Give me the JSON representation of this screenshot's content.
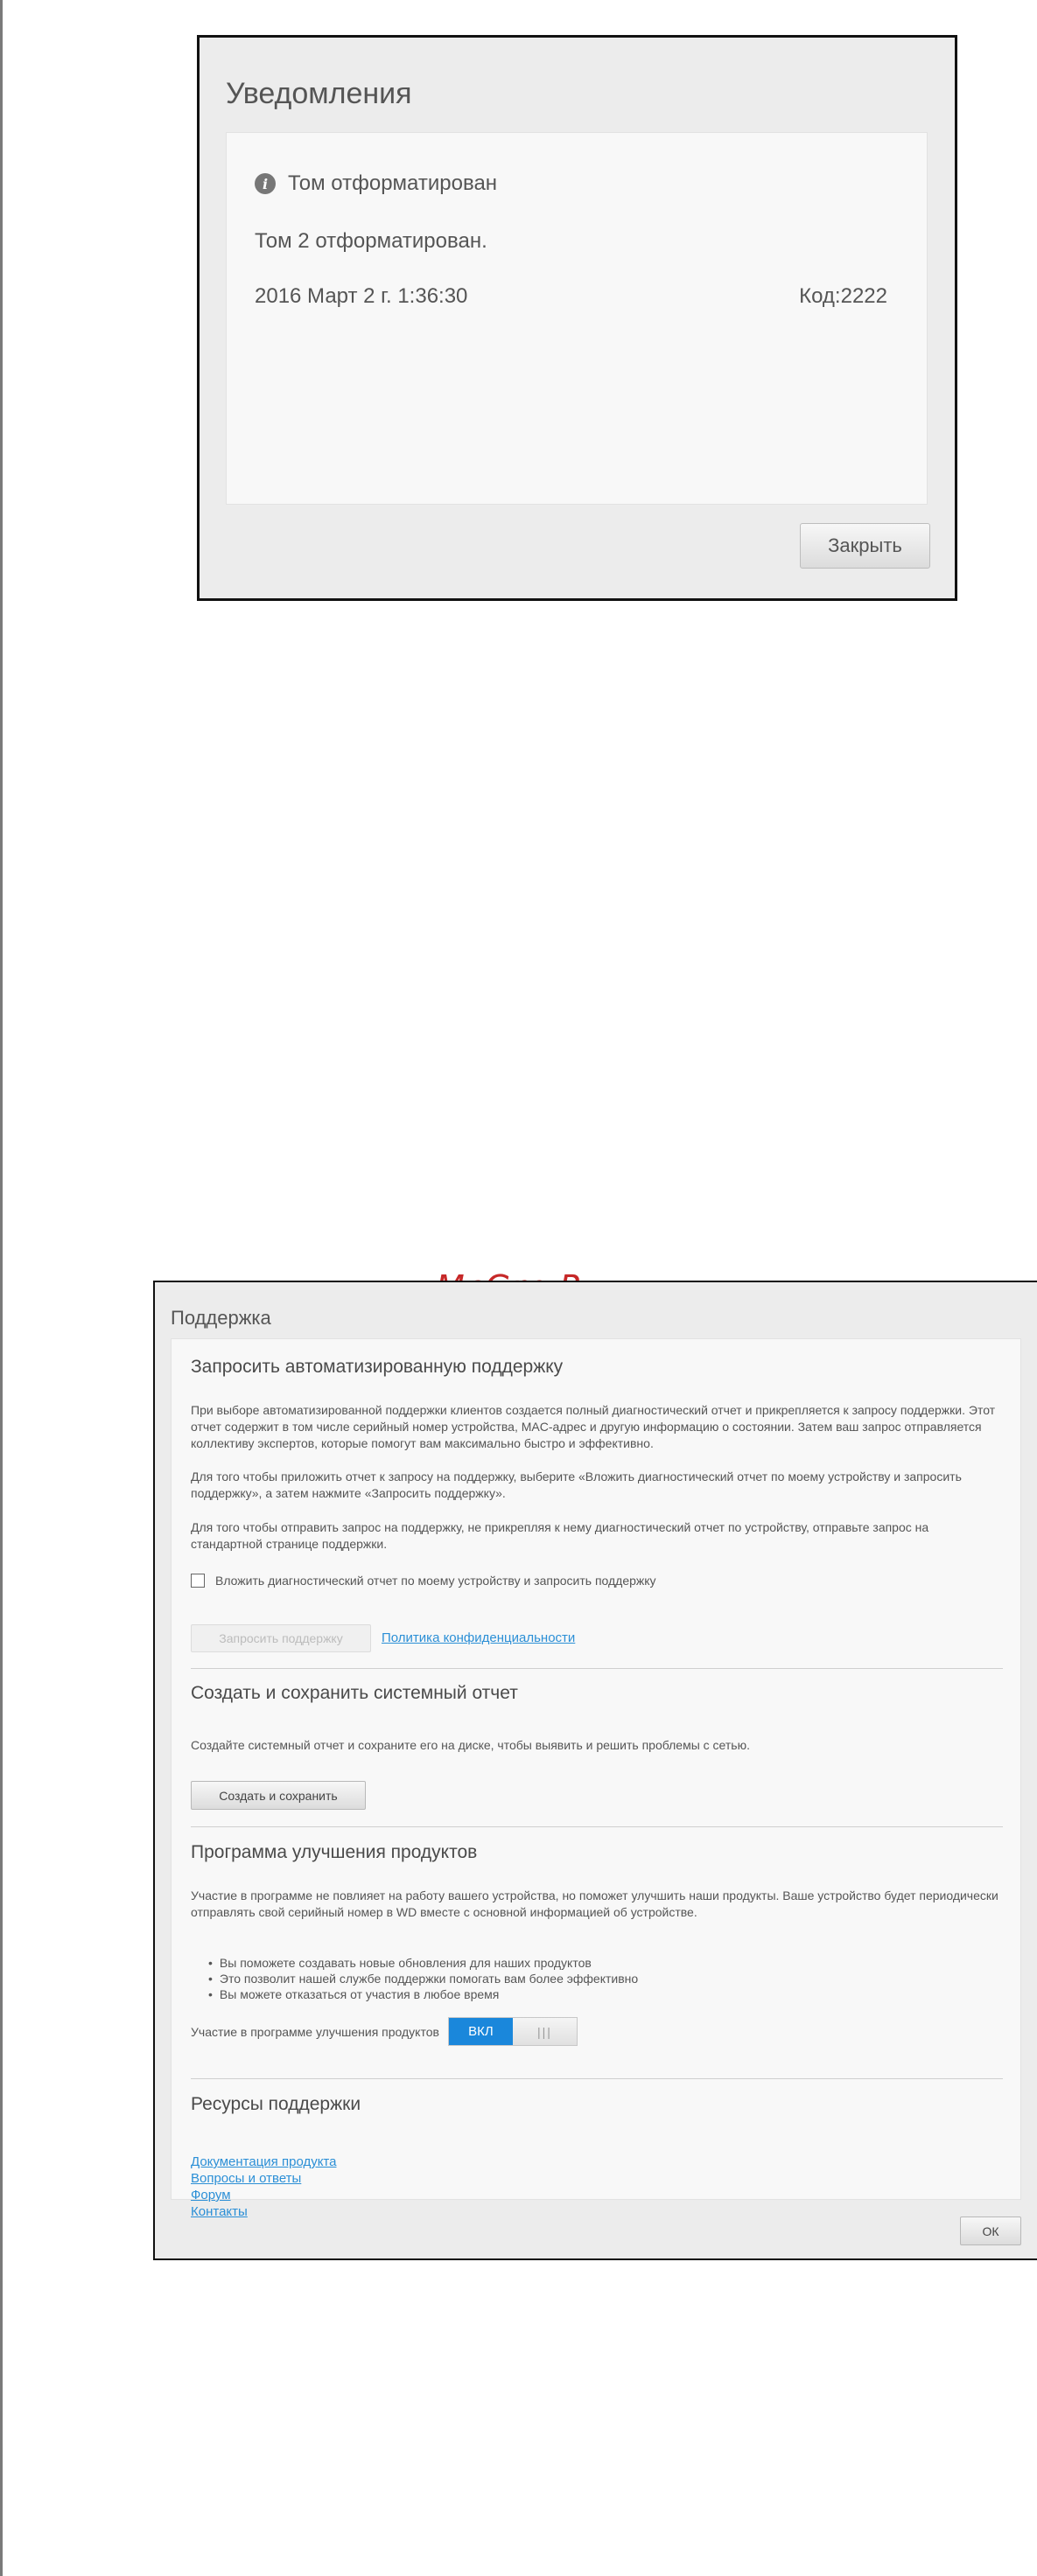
{
  "notifications": {
    "title": "Уведомления",
    "heading": "Том отформатирован",
    "message": "Том 2 отформатирован.",
    "date": "2016 Март 2 г. 1:36:30",
    "code": "Код:2222",
    "close_label": "Закрыть",
    "icon": "info-icon"
  },
  "support": {
    "title": "Поддержка",
    "auto_support": {
      "title": "Запросить автоматизированную поддержку",
      "para1": "При выборе автоматизированной поддержки клиентов создается полный диагностический отчет и прикрепляется к запросу поддержки. Этот отчет содержит в том числе серийный номер устройства, MAC-адрес и другую информацию о состоянии. Затем ваш запрос отправляется коллективу экспертов, которые помогут вам максимально быстро и эффективно.",
      "para2": "Для того чтобы приложить отчет к запросу на поддержку, выберите «Вложить диагностический отчет по моему устройству и запросить поддержку», а затем нажмите «Запросить поддержку».",
      "para3": "Для того чтобы отправить запрос на поддержку, не прикрепляя к нему диагностический отчет по устройству, отправьте запрос на стандартной странице поддержки.",
      "checkbox_label": "Вложить диагностический отчет по моему устройству и запросить поддержку",
      "checkbox_checked": false,
      "request_button": "Запросить поддержку",
      "privacy_link": "Политика конфиденциальности"
    },
    "system_report": {
      "title": "Создать и сохранить системный отчет",
      "description": "Создайте системный отчет и сохраните его на диске, чтобы выявить и решить проблемы с сетью.",
      "button": "Создать и сохранить"
    },
    "improvement": {
      "title": "Программа улучшения продуктов",
      "description": "Участие в программе не повлияет на работу вашего устройства, но поможет улучшить наши продукты. Ваше устройство будет периодически отправлять свой серийный номер в WD вместе с основной информацией об устройстве.",
      "bullets": [
        "Вы поможете создавать новые обновления для наших продуктов",
        "Это позволит нашей службе поддержки помогать вам более эффективно",
        "Вы можете отказаться от участия в любое время"
      ],
      "toggle_label": "Участие в программе улучшения продуктов",
      "toggle_on_label": "ВКЛ",
      "toggle_off_label": "|||",
      "toggle_state": "on",
      "accent": "#1a87db"
    },
    "resources": {
      "title": "Ресурсы поддержки",
      "links": [
        "Документация продукта",
        "Вопросы и ответы",
        "Форум",
        "Контакты"
      ]
    },
    "ok_label": "ОК"
  },
  "watermark": "McGrp.Ru"
}
